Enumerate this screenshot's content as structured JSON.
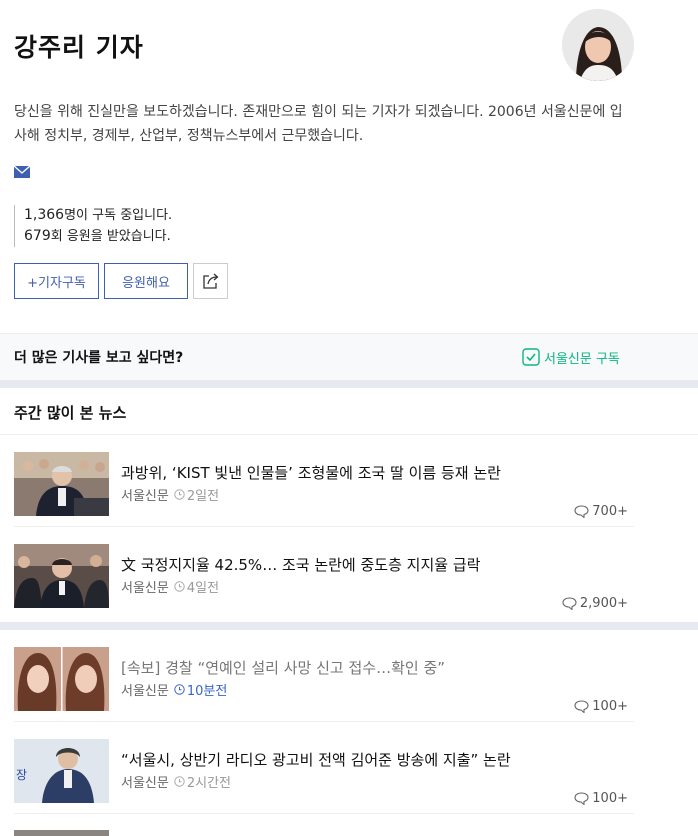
{
  "reporter": {
    "name": "강주리 기자",
    "bio": "당신을 위해 진실만을 보도하겠습니다. 존재만으로 힘이 되는 기자가 되겠습니다. 2006년 서울신문에 입사해 정치부, 경제부, 산업부, 정책뉴스부에서 근무했습니다.",
    "subscribers_num": "1,366",
    "subscribers_text": "명이 구독 중입니다.",
    "cheers_num": "679",
    "cheers_text": "회 응원을 받았습니다."
  },
  "buttons": {
    "subscribe": "+기자구독",
    "cheer": "응원해요"
  },
  "more": {
    "text": "더 많은 기사를 보고 싶다면?",
    "subscribe_label": "서울신문 구독"
  },
  "weekly": {
    "title": "주간 많이 본 뉴스",
    "items": [
      {
        "headline": "과방위, ‘KIST 빛낸 인물들’ 조형물에 조국 딸 이름 등재 논란",
        "source": "서울신문",
        "time": "2일전",
        "comments": "700+"
      },
      {
        "headline": "文 국정지지율 42.5%… 조국 논란에 중도층 지지율 급락",
        "source": "서울신문",
        "time": "4일전",
        "comments": "2,900+"
      }
    ]
  },
  "latest": {
    "items": [
      {
        "headline": "[속보] 경찰 “연예인 설리 사망 신고 접수…확인 중”",
        "source": "서울신문",
        "time": "10분전",
        "comments": "100+"
      },
      {
        "headline": "“서울시, 상반기 라디오 광고비 전액 김어준 방송에 지출” 논란",
        "source": "서울신문",
        "time": "2시간전",
        "comments": "100+"
      }
    ]
  },
  "colors": {
    "accent": "#3f5fb0",
    "green": "#0ab87b",
    "recent_time": "#3a63c9"
  }
}
